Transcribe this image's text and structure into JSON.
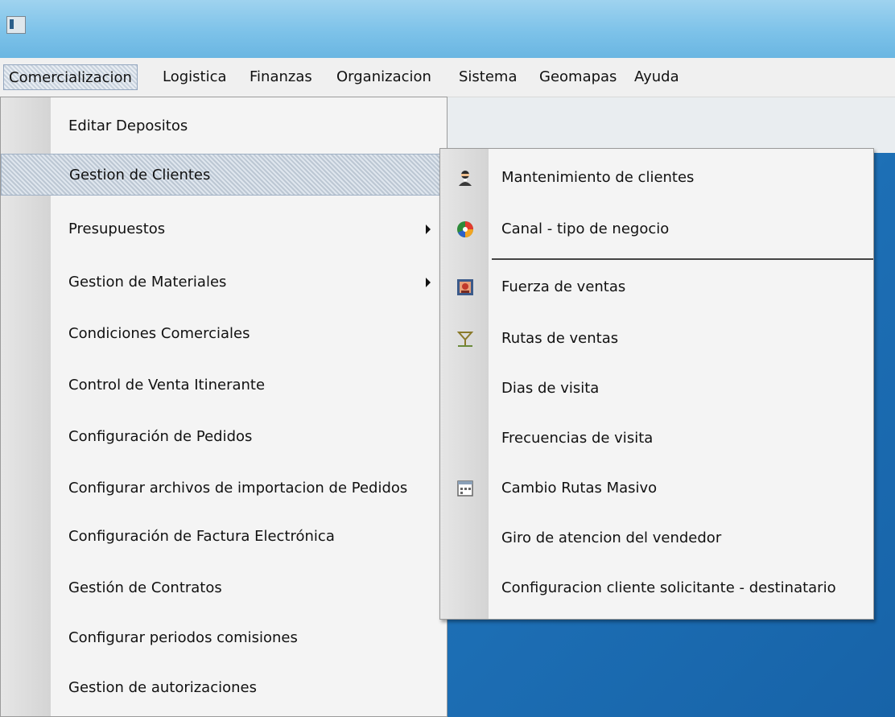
{
  "menubar": {
    "items": [
      {
        "label": "Comercializacion"
      },
      {
        "label": "Logistica"
      },
      {
        "label": "Finanzas"
      },
      {
        "label": "Organizacion"
      },
      {
        "label": "Sistema"
      },
      {
        "label": "Geomapas"
      },
      {
        "label": "Ayuda"
      }
    ]
  },
  "dropdown": {
    "items": [
      {
        "label": "Editar Depositos"
      },
      {
        "label": "Gestion de Clientes"
      },
      {
        "label": "Presupuestos"
      },
      {
        "label": "Gestion de Materiales"
      },
      {
        "label": "Condiciones Comerciales"
      },
      {
        "label": "Control de Venta Itinerante"
      },
      {
        "label": "Configuración de Pedidos"
      },
      {
        "label": "Configurar archivos de importacion de Pedidos"
      },
      {
        "label": "Configuración de Factura Electrónica"
      },
      {
        "label": "Gestión de Contratos"
      },
      {
        "label": "Configurar periodos comisiones"
      },
      {
        "label": "Gestion de autorizaciones"
      }
    ]
  },
  "submenu": {
    "items": [
      {
        "label": "Mantenimiento de clientes",
        "icon": "customer-icon"
      },
      {
        "label": "Canal - tipo de negocio",
        "icon": "pie-chart-icon"
      },
      {
        "label": "Fuerza de ventas",
        "icon": "salesforce-icon"
      },
      {
        "label": "Rutas de ventas",
        "icon": "route-icon"
      },
      {
        "label": "Dias de visita",
        "icon": ""
      },
      {
        "label": "Frecuencias de visita",
        "icon": ""
      },
      {
        "label": "Cambio Rutas Masivo",
        "icon": "calendar-icon"
      },
      {
        "label": "Giro de atencion del vendedor",
        "icon": ""
      },
      {
        "label": "Configuracion cliente solicitante - destinatario",
        "icon": ""
      }
    ]
  },
  "colors": {
    "titlebar": "#7dc2e9",
    "desktop_blue": "#1d6fb5",
    "menu_bg": "#f4f4f4"
  }
}
